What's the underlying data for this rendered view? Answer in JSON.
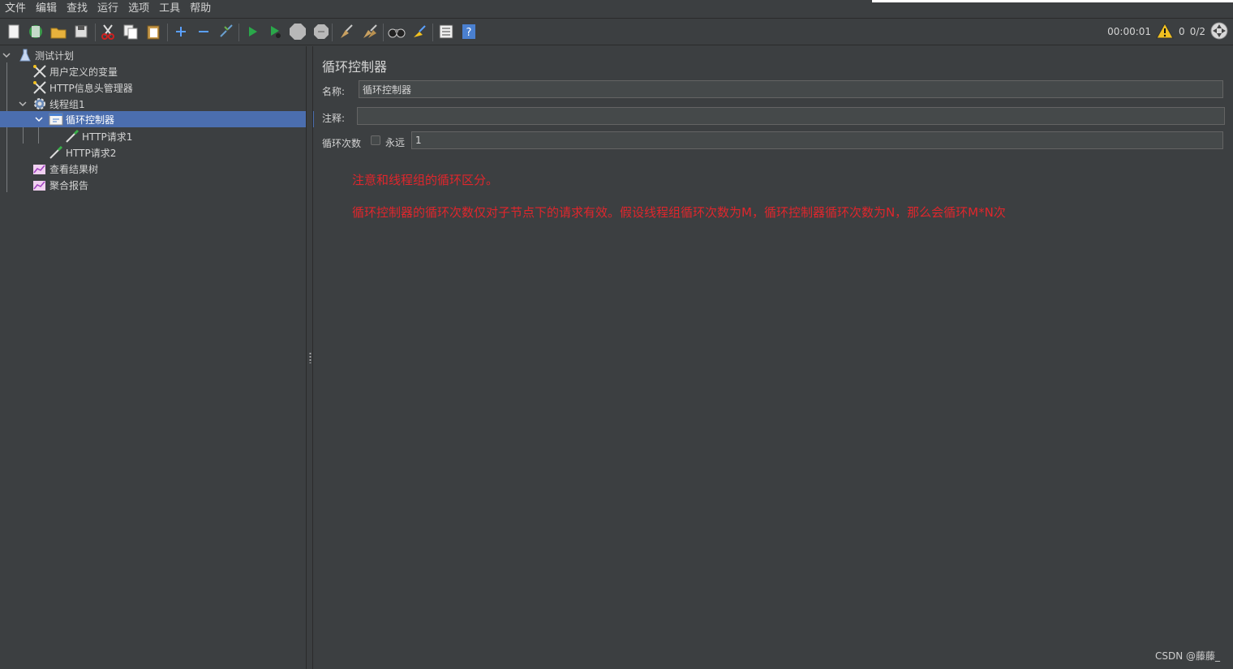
{
  "menubar": {
    "items": [
      "文件",
      "编辑",
      "查找",
      "运行",
      "选项",
      "工具",
      "帮助"
    ]
  },
  "toolbar": {
    "icons": [
      "new-icon",
      "templates-icon",
      "open-icon",
      "save-icon",
      "cut-icon",
      "copy-icon",
      "paste-icon",
      "expand-icon",
      "collapse-icon",
      "toggle-icon",
      "start-icon",
      "start-no-pause-icon",
      "stop-icon",
      "shutdown-icon",
      "clear-icon",
      "clear-all-icon",
      "search-icon",
      "reset-search-icon",
      "function-helper-icon",
      "help-icon"
    ]
  },
  "status": {
    "timer": "00:00:01",
    "warnings": "0",
    "threads": "0/2"
  },
  "tree": {
    "items": [
      {
        "label": "测试计划",
        "icon": "flask-icon"
      },
      {
        "label": "用户定义的变量",
        "icon": "wrench-icon"
      },
      {
        "label": "HTTP信息头管理器",
        "icon": "wrench-icon"
      },
      {
        "label": "线程组1",
        "icon": "gear-icon"
      },
      {
        "label": "循环控制器",
        "icon": "controller-icon"
      },
      {
        "label": "HTTP请求1",
        "icon": "pipette-icon"
      },
      {
        "label": "HTTP请求2",
        "icon": "pipette-icon"
      },
      {
        "label": "查看结果树",
        "icon": "chart-icon"
      },
      {
        "label": "聚合报告",
        "icon": "chart-icon"
      }
    ]
  },
  "panel": {
    "title": "循环控制器",
    "name_label": "名称:",
    "name_value": "循环控制器",
    "comment_label": "注释:",
    "comment_value": "",
    "loop_label": "循环次数",
    "forever_label": "永远",
    "loop_value": "1"
  },
  "notes": {
    "line1": "注意和线程组的循环区分。",
    "line2": "循环控制器的循环次数仅对子节点下的请求有效。假设线程组循环次数为M，循环控制器循环次数为N，那么会循环M*N次"
  },
  "watermark": "CSDN @藤藤_",
  "colors": {
    "background": "#3c3f41",
    "selection": "#4b6eaf",
    "note_red": "#e0262c"
  }
}
